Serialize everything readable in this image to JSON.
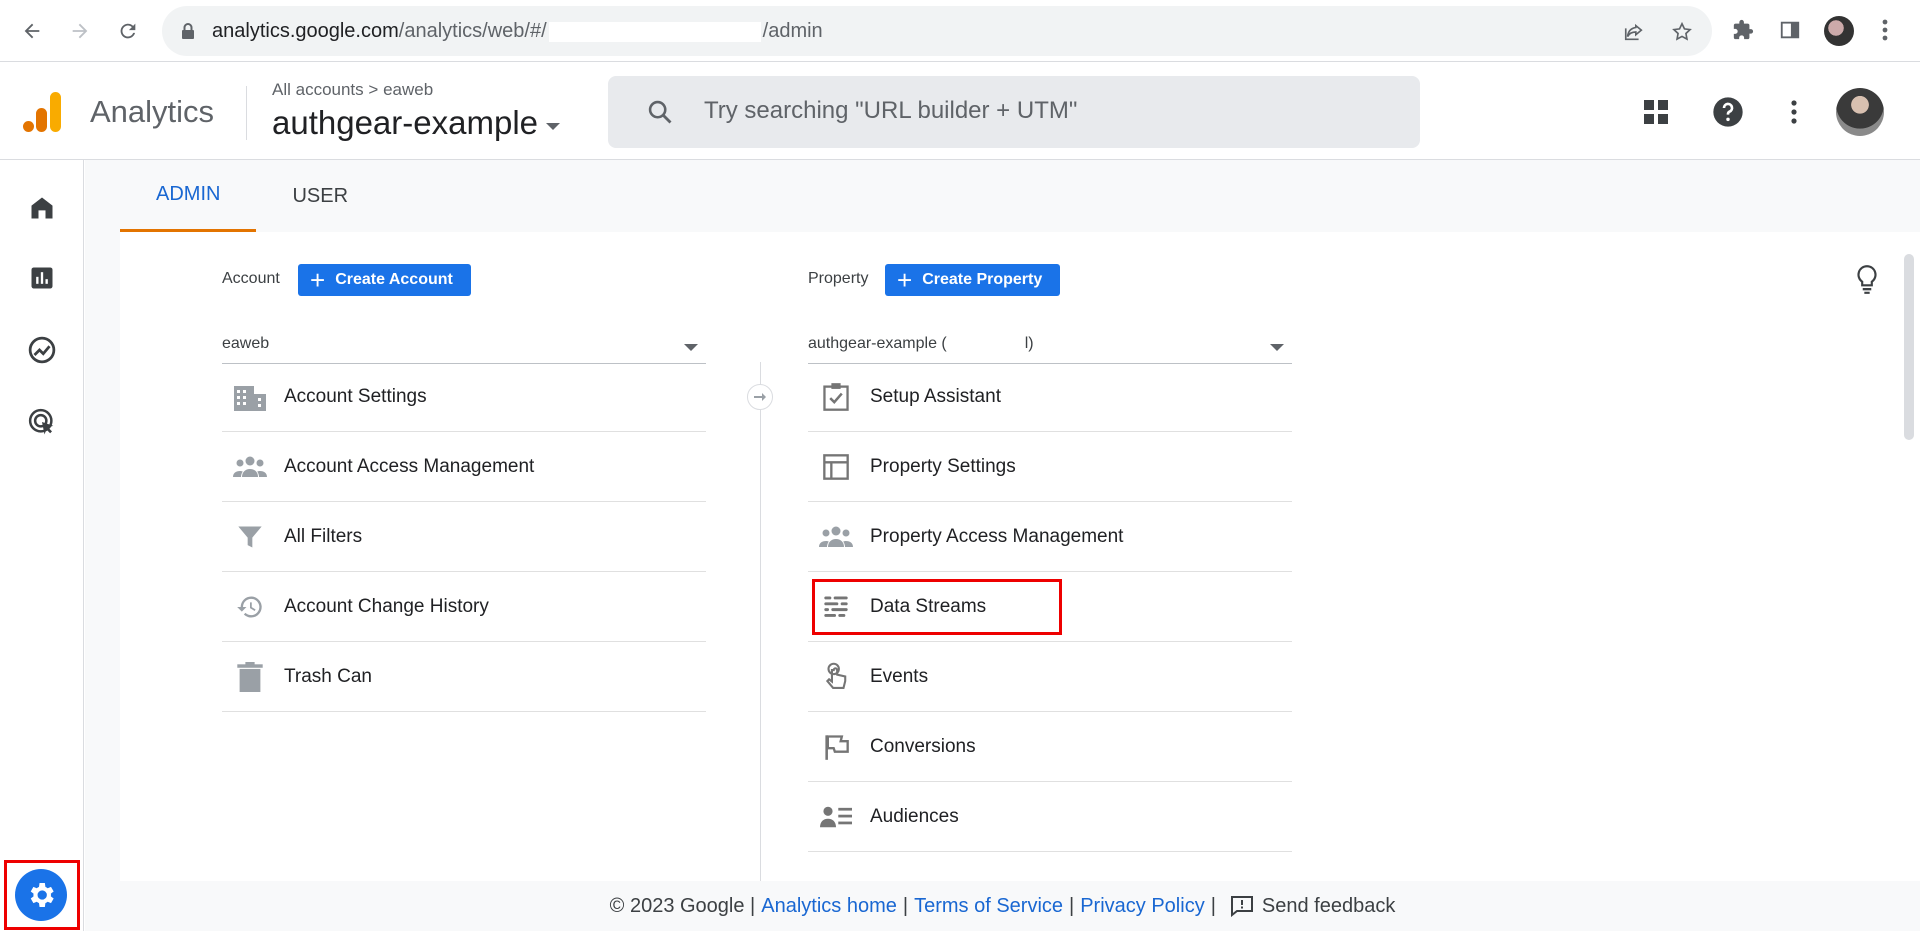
{
  "browser": {
    "url_host": "analytics.google.com",
    "url_path_start": "/analytics/web/#/",
    "url_path_end": "/admin",
    "icons": [
      "back-icon",
      "forward-icon",
      "reload-icon",
      "lock-icon",
      "share-icon",
      "star-icon",
      "extensions-icon",
      "side-panel-icon",
      "menu-dots-icon"
    ]
  },
  "header": {
    "app_name": "Analytics",
    "crumb_all": "All accounts",
    "crumb_sep": ">",
    "crumb_account": "eaweb",
    "property": "authgear-example",
    "search_placeholder": "Try searching \"URL builder + UTM\""
  },
  "tabs": [
    {
      "label": "ADMIN",
      "active": true
    },
    {
      "label": "USER",
      "active": false
    }
  ],
  "account": {
    "label": "Account",
    "create_label": "Create Account",
    "selected": "eaweb",
    "items": [
      {
        "label": "Account Settings",
        "icon": "building-icon"
      },
      {
        "label": "Account Access Management",
        "icon": "people-icon"
      },
      {
        "label": "All Filters",
        "icon": "filter-icon"
      },
      {
        "label": "Account Change History",
        "icon": "history-icon"
      },
      {
        "label": "Trash Can",
        "icon": "trash-icon"
      }
    ]
  },
  "property": {
    "label": "Property",
    "create_label": "Create Property",
    "selected_prefix": "authgear-example (",
    "selected_suffix": "l)",
    "items": [
      {
        "label": "Setup Assistant",
        "icon": "checkbox-icon"
      },
      {
        "label": "Property Settings",
        "icon": "layout-icon"
      },
      {
        "label": "Property Access Management",
        "icon": "people-icon"
      },
      {
        "label": "Data Streams",
        "icon": "streams-icon",
        "highlighted": true
      },
      {
        "label": "Events",
        "icon": "touch-icon"
      },
      {
        "label": "Conversions",
        "icon": "flag-icon"
      },
      {
        "label": "Audiences",
        "icon": "audience-icon"
      }
    ]
  },
  "footer": {
    "copyright": "© 2023 Google |",
    "analytics_home": "Analytics home",
    "sep": "|",
    "terms": "Terms of Service",
    "privacy": "Privacy Policy",
    "send_feedback": "Send feedback"
  },
  "colors": {
    "accent": "#1a73e8",
    "tab_active": "#1967d2",
    "tab_indicator": "#e37400",
    "highlight": "#ee0000"
  }
}
